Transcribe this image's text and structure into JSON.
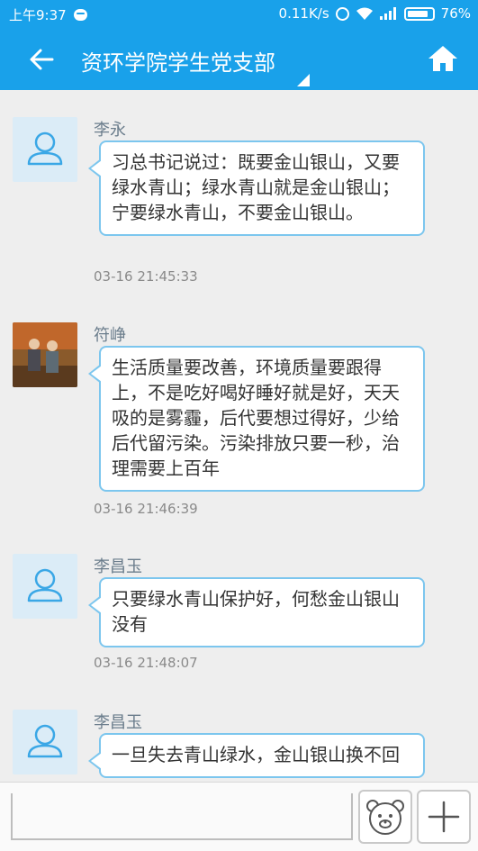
{
  "status_bar": {
    "time": "上午9:37",
    "network_speed": "0.11K/s",
    "battery": "76%"
  },
  "header": {
    "title": "资环学院学生党支部"
  },
  "messages": [
    {
      "sender": "李永",
      "avatar": "default-user-avatar",
      "text": "习总书记说过：既要金山银山，又要绿水青山；绿水青山就是金山银山；宁要绿水青山，不要金山银山。",
      "time": "03-16 21:45:33"
    },
    {
      "sender": "符峥",
      "avatar": "photo-avatar",
      "text": "生活质量要改善，环境质量要跟得上，不是吃好喝好睡好就是好，天天吸的是雾霾，后代要想过得好，少给后代留污染。污染排放只要一秒，治理需要上百年",
      "time": "03-16 21:46:39"
    },
    {
      "sender": "李昌玉",
      "avatar": "default-user-avatar",
      "text": "只要绿水青山保护好，何愁金山银山没有",
      "time": "03-16 21:48:07"
    },
    {
      "sender": "李昌玉",
      "avatar": "default-user-avatar",
      "text": "一旦失去青山绿水，金山银山换不回",
      "time": ""
    }
  ],
  "input_bar": {
    "placeholder": ""
  },
  "colors": {
    "primary": "#19a1ea",
    "bubble_border": "#7cc6ee",
    "avatar_bg": "#dbecf7"
  },
  "icons": {
    "back": "arrow-left-icon",
    "home": "home-icon",
    "emoji": "bear-emoji-icon",
    "add": "plus-icon"
  }
}
